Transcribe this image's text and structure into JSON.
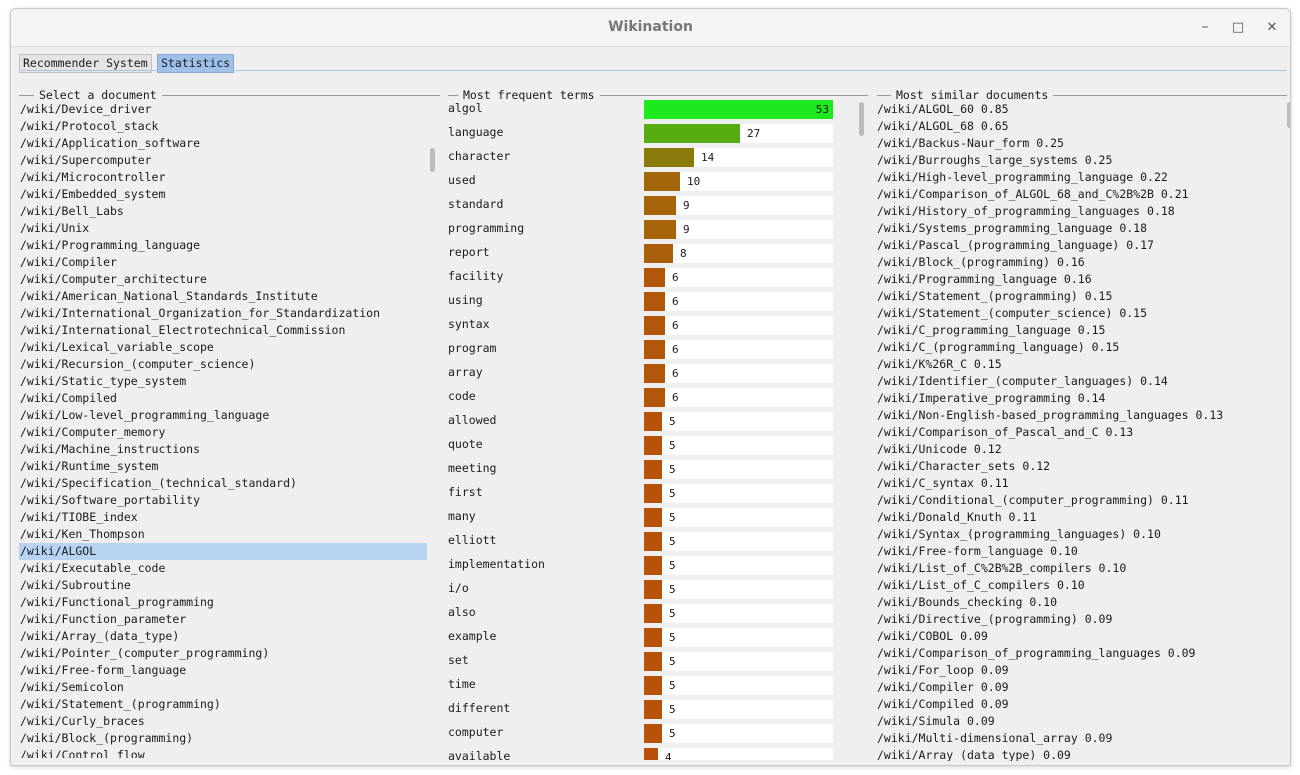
{
  "window": {
    "title": "Wikination",
    "minimize_label": "–",
    "maximize_label": "□",
    "close_label": "✕"
  },
  "tabs": [
    {
      "label": "Recommender System",
      "active": false
    },
    {
      "label": "Statistics",
      "active": true
    }
  ],
  "sections": {
    "documents_title": "Select a document",
    "terms_title": "Most frequent terms",
    "similar_title": "Most similar documents"
  },
  "documents": [
    "/wiki/Device_driver",
    "/wiki/Protocol_stack",
    "/wiki/Application_software",
    "/wiki/Supercomputer",
    "/wiki/Microcontroller",
    "/wiki/Embedded_system",
    "/wiki/Bell_Labs",
    "/wiki/Unix",
    "/wiki/Programming_language",
    "/wiki/Compiler",
    "/wiki/Computer_architecture",
    "/wiki/American_National_Standards_Institute",
    "/wiki/International_Organization_for_Standardization",
    "/wiki/International_Electrotechnical_Commission",
    "/wiki/Lexical_variable_scope",
    "/wiki/Recursion_(computer_science)",
    "/wiki/Static_type_system",
    "/wiki/Compiled",
    "/wiki/Low-level_programming_language",
    "/wiki/Computer_memory",
    "/wiki/Machine_instructions",
    "/wiki/Runtime_system",
    "/wiki/Specification_(technical_standard)",
    "/wiki/Software_portability",
    "/wiki/TIOBE_index",
    "/wiki/Ken_Thompson",
    "/wiki/ALGOL",
    "/wiki/Executable_code",
    "/wiki/Subroutine",
    "/wiki/Functional_programming",
    "/wiki/Function_parameter",
    "/wiki/Array_(data_type)",
    "/wiki/Pointer_(computer_programming)",
    "/wiki/Free-form_language",
    "/wiki/Semicolon",
    "/wiki/Statement_(programming)",
    "/wiki/Curly_braces",
    "/wiki/Block_(programming)",
    "/wiki/Control_flow"
  ],
  "selected_document": "/wiki/ALGOL",
  "term_max": 53,
  "terms": [
    {
      "term": "algol",
      "count": 53,
      "color": "#1ee81e"
    },
    {
      "term": "language",
      "count": 27,
      "color": "#55ad11"
    },
    {
      "term": "character",
      "count": 14,
      "color": "#8a7a0a"
    },
    {
      "term": "used",
      "count": 10,
      "color": "#a2670a"
    },
    {
      "term": "standard",
      "count": 9,
      "color": "#a6630a"
    },
    {
      "term": "programming",
      "count": 9,
      "color": "#a6630a"
    },
    {
      "term": "report",
      "count": 8,
      "color": "#aa600a"
    },
    {
      "term": "facility",
      "count": 6,
      "color": "#b2560a"
    },
    {
      "term": "using",
      "count": 6,
      "color": "#b2560a"
    },
    {
      "term": "syntax",
      "count": 6,
      "color": "#b2560a"
    },
    {
      "term": "program",
      "count": 6,
      "color": "#b2560a"
    },
    {
      "term": "array",
      "count": 6,
      "color": "#b2560a"
    },
    {
      "term": "code",
      "count": 6,
      "color": "#b2560a"
    },
    {
      "term": "allowed",
      "count": 5,
      "color": "#b6520a"
    },
    {
      "term": "quote",
      "count": 5,
      "color": "#b6520a"
    },
    {
      "term": "meeting",
      "count": 5,
      "color": "#b6520a"
    },
    {
      "term": "first",
      "count": 5,
      "color": "#b6520a"
    },
    {
      "term": "many",
      "count": 5,
      "color": "#b6520a"
    },
    {
      "term": "elliott",
      "count": 5,
      "color": "#b6520a"
    },
    {
      "term": "implementation",
      "count": 5,
      "color": "#b6520a"
    },
    {
      "term": "i/o",
      "count": 5,
      "color": "#b6520a"
    },
    {
      "term": "also",
      "count": 5,
      "color": "#b6520a"
    },
    {
      "term": "example",
      "count": 5,
      "color": "#b6520a"
    },
    {
      "term": "set",
      "count": 5,
      "color": "#b6520a"
    },
    {
      "term": "time",
      "count": 5,
      "color": "#b6520a"
    },
    {
      "term": "different",
      "count": 5,
      "color": "#b6520a"
    },
    {
      "term": "computer",
      "count": 5,
      "color": "#b6520a"
    },
    {
      "term": "available",
      "count": 4,
      "color": "#ba4e0a"
    }
  ],
  "similar": [
    "/wiki/ALGOL_60 0.85",
    "/wiki/ALGOL_68 0.65",
    "/wiki/Backus-Naur_form 0.25",
    "/wiki/Burroughs_large_systems 0.25",
    "/wiki/High-level_programming_language 0.22",
    "/wiki/Comparison_of_ALGOL_68_and_C%2B%2B 0.21",
    "/wiki/History_of_programming_languages 0.18",
    "/wiki/Systems_programming_language 0.18",
    "/wiki/Pascal_(programming_language) 0.17",
    "/wiki/Block_(programming) 0.16",
    "/wiki/Programming_language 0.16",
    "/wiki/Statement_(programming) 0.15",
    "/wiki/Statement_(computer_science) 0.15",
    "/wiki/C_programming_language 0.15",
    "/wiki/C_(programming_language) 0.15",
    "/wiki/K%26R_C 0.15",
    "/wiki/Identifier_(computer_languages) 0.14",
    "/wiki/Imperative_programming 0.14",
    "/wiki/Non-English-based_programming_languages 0.13",
    "/wiki/Comparison_of_Pascal_and_C 0.13",
    "/wiki/Unicode 0.12",
    "/wiki/Character_sets 0.12",
    "/wiki/C_syntax 0.11",
    "/wiki/Conditional_(computer_programming) 0.11",
    "/wiki/Donald_Knuth 0.11",
    "/wiki/Syntax_(programming_languages) 0.10",
    "/wiki/Free-form_language 0.10",
    "/wiki/List_of_C%2B%2B_compilers 0.10",
    "/wiki/List_of_C_compilers 0.10",
    "/wiki/Bounds_checking 0.10",
    "/wiki/Directive_(programming) 0.09",
    "/wiki/COBOL 0.09",
    "/wiki/Comparison_of_programming_languages 0.09",
    "/wiki/For_loop 0.09",
    "/wiki/Compiler 0.09",
    "/wiki/Compiled 0.09",
    "/wiki/Simula 0.09",
    "/wiki/Multi-dimensional_array 0.09",
    "/wiki/Array_(data_type) 0.09"
  ]
}
